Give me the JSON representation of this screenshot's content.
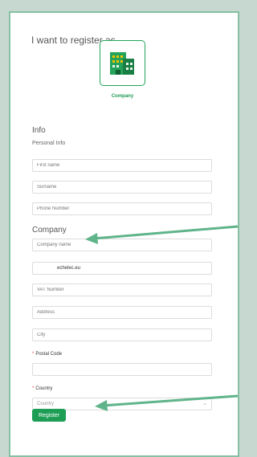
{
  "form": {
    "heading": "I want to register as...",
    "role": {
      "label": "Company",
      "icon": "building-icon",
      "accent": "#23a45a"
    },
    "info": {
      "section_title": "Info",
      "sub_title": "Personal Info",
      "first_name_placeholder": "First name",
      "surname_placeholder": "Surname",
      "phone_placeholder": "Phone Number"
    },
    "company": {
      "section_title": "Company",
      "company_name_placeholder": "Company name",
      "email_value": "echelec.eu",
      "vat_placeholder": "VAT Number",
      "address_placeholder": "Address",
      "city_placeholder": "City",
      "postal_label": "Postal Code",
      "country_label": "Country",
      "country_value": "Country",
      "required_mark": "*"
    },
    "register_label": "Register"
  },
  "colors": {
    "background": "#c6d8cf",
    "card_border": "#87c1a4",
    "button": "#1e9e55",
    "arrow": "#5fb48a"
  }
}
